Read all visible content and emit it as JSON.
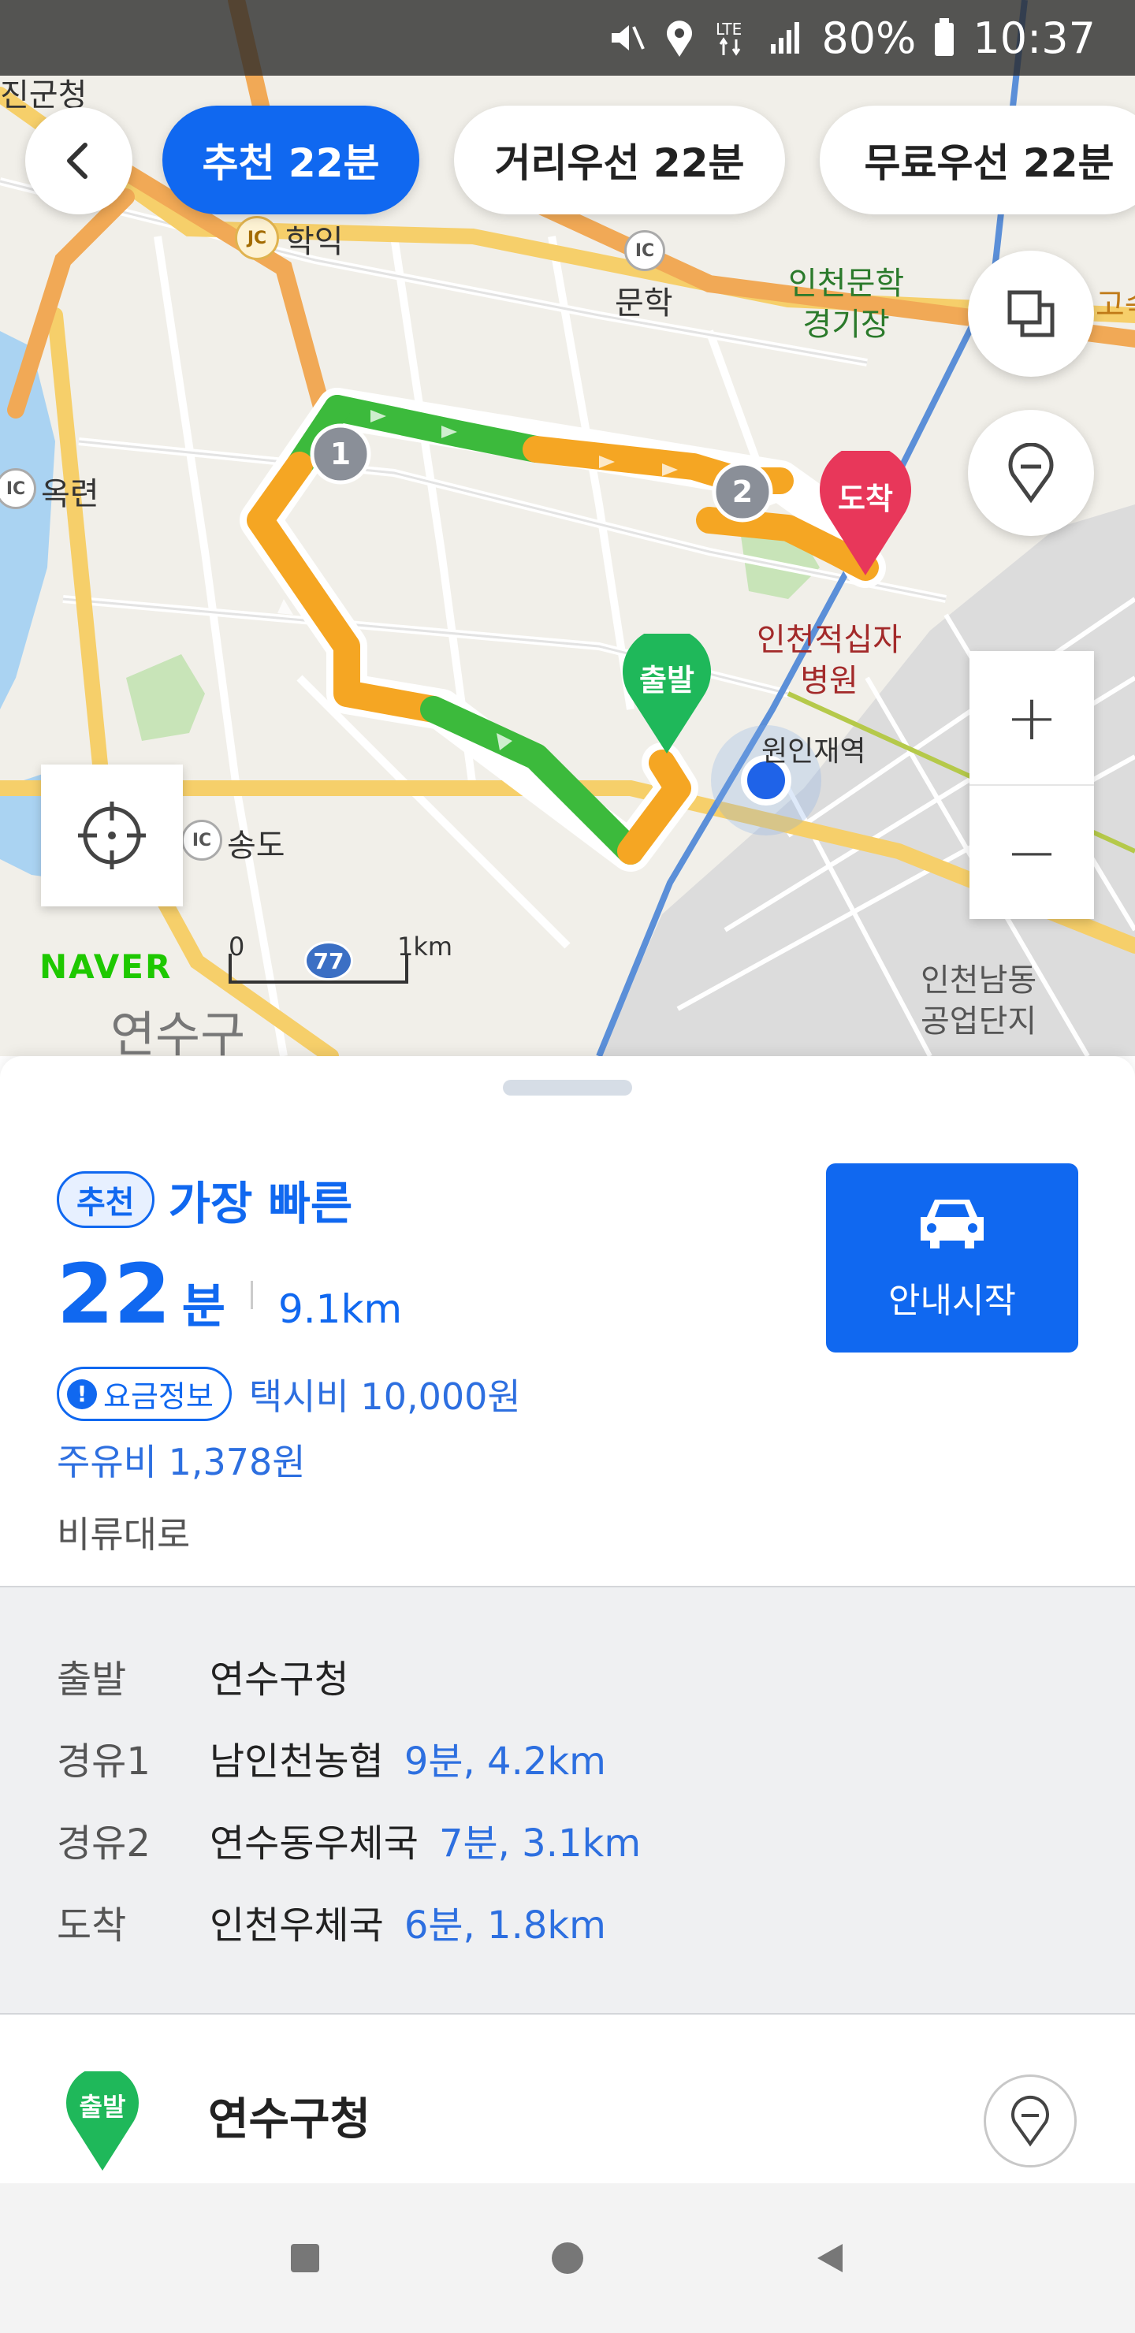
{
  "status_bar": {
    "battery": "80%",
    "time": "10:37",
    "network": "LTE"
  },
  "route_tabs": [
    {
      "label": "추천 22분",
      "active": true
    },
    {
      "label": "거리우선 22분",
      "active": false
    },
    {
      "label": "무료우선 22분",
      "active": false
    }
  ],
  "map": {
    "labels": {
      "top_left": "진군청",
      "hakik": "학익",
      "munhak": "문학",
      "stadium_line1": "인천문학",
      "stadium_line2": "경기장",
      "goj": "고속",
      "okryeon": "옥련",
      "hospital_line1": "인천적십자",
      "hospital_line2": "병원",
      "station": "원인재역",
      "songdo": "송도",
      "yeonsugu": "연수구",
      "industrial_line1": "인천남동",
      "industrial_line2": "공업단지"
    },
    "badges": {
      "ic": "IC",
      "jc": "JC",
      "route_no": "77"
    },
    "markers": {
      "start": "출발",
      "end": "도착",
      "wp1": "1",
      "wp2": "2"
    },
    "brand": "NAVER",
    "scale": {
      "zero": "0",
      "km": "1km"
    },
    "zoom": {
      "in": "+",
      "out": "−"
    }
  },
  "summary": {
    "badge": "추천",
    "title": "가장 빠른",
    "time_value": "22",
    "time_unit": "분",
    "distance": "9.1km",
    "fee_badge": "요금정보",
    "taxi_fee": "택시비 10,000원",
    "fuel_cost": "주유비 1,378원",
    "road": "비류대로",
    "start_button": "안내시작"
  },
  "waypoints": [
    {
      "tag": "출발",
      "name": "연수구청",
      "info": ""
    },
    {
      "tag": "경유1",
      "name": "남인천농협",
      "info": "9분, 4.2km"
    },
    {
      "tag": "경유2",
      "name": "연수동우체국",
      "info": "7분, 3.1km"
    },
    {
      "tag": "도착",
      "name": "인천우체국",
      "info": "6분, 1.8km"
    }
  ],
  "stop_card": {
    "pin_label": "출발",
    "name": "연수구청"
  },
  "colors": {
    "accent": "#1068f0",
    "route_green": "#3cba3c",
    "route_orange": "#f5a623",
    "end_pin": "#e8375a",
    "start_pin": "#1fb85a"
  }
}
